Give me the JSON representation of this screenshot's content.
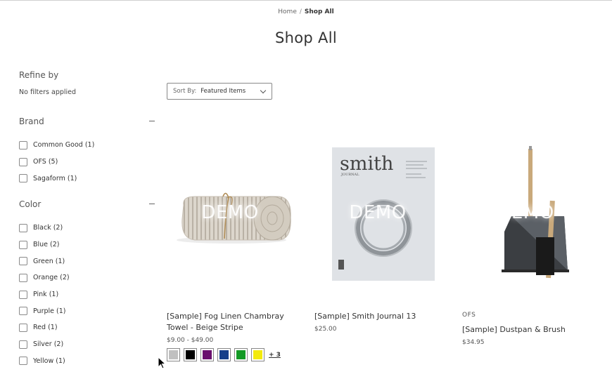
{
  "breadcrumb": {
    "home": "Home",
    "separator": "/",
    "current": "Shop All"
  },
  "page_title": "Shop All",
  "sidebar": {
    "refine_title": "Refine by",
    "no_filters": "No filters applied",
    "brand": {
      "title": "Brand",
      "items": [
        {
          "label": "Common Good (1)"
        },
        {
          "label": "OFS (5)"
        },
        {
          "label": "Sagaform (1)"
        }
      ]
    },
    "color": {
      "title": "Color",
      "items": [
        {
          "label": "Black (2)"
        },
        {
          "label": "Blue (2)"
        },
        {
          "label": "Green (1)"
        },
        {
          "label": "Orange (2)"
        },
        {
          "label": "Pink (1)"
        },
        {
          "label": "Purple (1)"
        },
        {
          "label": "Red (1)"
        },
        {
          "label": "Silver (2)"
        },
        {
          "label": "Yellow (1)"
        }
      ]
    }
  },
  "sort": {
    "label": "Sort By:",
    "value": "Featured Items"
  },
  "products": [
    {
      "title": "[Sample] Fog Linen Chambray Towel - Beige Stripe",
      "price": "$9.00 - $49.00",
      "image_overlay": "DEMO",
      "swatches": [
        "#c0c0c0",
        "#000000",
        "#6a0f6e",
        "#153e8a",
        "#139a25",
        "#f3ea0b"
      ],
      "more_swatches": "+ 3"
    },
    {
      "title": "[Sample] Smith Journal 13",
      "price": "$25.00",
      "image_overlay": "DEMO",
      "magazine_title": "smith",
      "magazine_sub": "JOURNAL"
    },
    {
      "brand": "OFS",
      "title": "[Sample] Dustpan & Brush",
      "price": "$34.95",
      "image_overlay": "DEMO"
    }
  ]
}
